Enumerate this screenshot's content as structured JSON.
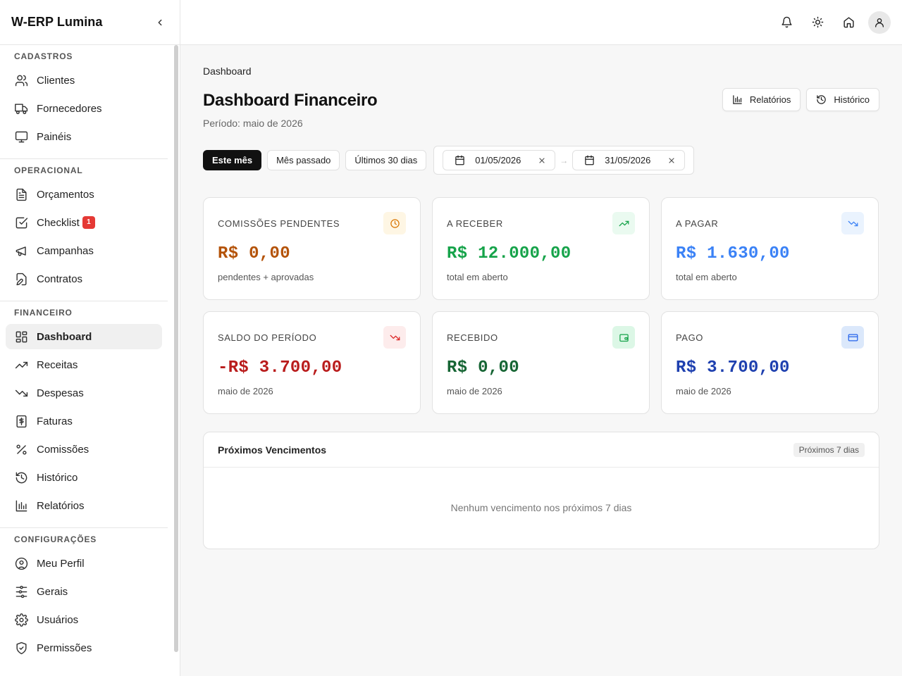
{
  "sidebar": {
    "brand": "W-ERP Lumina",
    "sections": [
      {
        "title": "CADASTROS",
        "items": [
          {
            "label": "Clientes",
            "icon": "users-icon"
          },
          {
            "label": "Fornecedores",
            "icon": "truck-icon"
          },
          {
            "label": "Painéis",
            "icon": "monitor-icon"
          }
        ]
      },
      {
        "title": "OPERACIONAL",
        "items": [
          {
            "label": "Orçamentos",
            "icon": "file-text-icon"
          },
          {
            "label": "Checklist",
            "icon": "check-square-icon",
            "badge": "1"
          },
          {
            "label": "Campanhas",
            "icon": "megaphone-icon"
          },
          {
            "label": "Contratos",
            "icon": "file-edit-icon"
          }
        ]
      },
      {
        "title": "FINANCEIRO",
        "items": [
          {
            "label": "Dashboard",
            "icon": "layout-dashboard-icon",
            "active": true
          },
          {
            "label": "Receitas",
            "icon": "trending-up-icon"
          },
          {
            "label": "Despesas",
            "icon": "trending-down-icon"
          },
          {
            "label": "Faturas",
            "icon": "receipt-dollar-icon"
          },
          {
            "label": "Comissões",
            "icon": "percent-icon"
          },
          {
            "label": "Histórico",
            "icon": "history-icon"
          },
          {
            "label": "Relatórios",
            "icon": "bar-chart-icon"
          }
        ]
      },
      {
        "title": "CONFIGURAÇÕES",
        "items": [
          {
            "label": "Meu Perfil",
            "icon": "user-circle-icon"
          },
          {
            "label": "Gerais",
            "icon": "sliders-icon"
          },
          {
            "label": "Usuários",
            "icon": "settings-icon"
          },
          {
            "label": "Permissões",
            "icon": "shield-check-icon"
          }
        ]
      }
    ]
  },
  "main": {
    "breadcrumb": "Dashboard",
    "title": "Dashboard Financeiro",
    "period": "Período: maio de 2026",
    "actions": {
      "reports": "Relatórios",
      "history": "Histórico"
    },
    "filters": [
      "Este mês",
      "Mês passado",
      "Últimos 30 dias"
    ],
    "date_from": "01/05/2026",
    "date_to": "31/05/2026",
    "date_sep": "→",
    "cards": [
      {
        "label": "COMISSÕES PENDENTES",
        "value": "R$ 0,00",
        "sub": "pendentes + aprovadas",
        "color": "#b45309",
        "icon": "clock-icon",
        "icon_bg": "#fef6e4",
        "icon_color": "#d97706"
      },
      {
        "label": "A RECEBER",
        "value": "R$ 12.000,00",
        "sub": "total em aberto",
        "color": "#16a34a",
        "icon": "trending-up-icon",
        "icon_bg": "#eafaf0",
        "icon_color": "#16a34a"
      },
      {
        "label": "A PAGAR",
        "value": "R$ 1.630,00",
        "sub": "total em aberto",
        "color": "#3b82f6",
        "icon": "trending-down-icon",
        "icon_bg": "#eaf3fe",
        "icon_color": "#3b82f6"
      },
      {
        "label": "SALDO DO PERÍODO",
        "value": "-R$ 3.700,00",
        "sub": "maio de 2026",
        "color": "#b91c1c",
        "icon": "trending-down-icon",
        "icon_bg": "#fdecec",
        "icon_color": "#dc2626"
      },
      {
        "label": "RECEBIDO",
        "value": "R$ 0,00",
        "sub": "maio de 2026",
        "color": "#166534",
        "icon": "wallet-icon",
        "icon_bg": "#dcf7e6",
        "icon_color": "#16a34a"
      },
      {
        "label": "PAGO",
        "value": "R$ 3.700,00",
        "sub": "maio de 2026",
        "color": "#1e40af",
        "icon": "credit-card-icon",
        "icon_bg": "#dbe8fb",
        "icon_color": "#2563eb"
      }
    ],
    "upcoming": {
      "title": "Próximos Vencimentos",
      "pill": "Próximos 7 dias",
      "empty": "Nenhum vencimento nos próximos 7 dias"
    }
  }
}
